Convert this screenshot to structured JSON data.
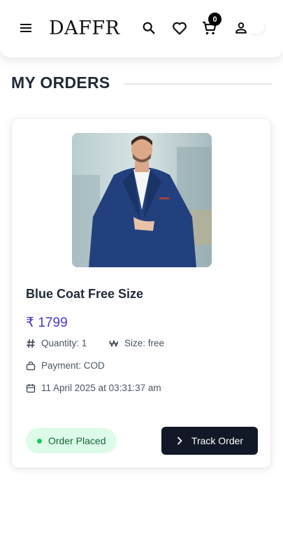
{
  "header": {
    "logo": "DAFFR",
    "cart_count": "0",
    "icons": [
      "menu-icon",
      "search-icon",
      "heart-icon",
      "cart-icon",
      "user-icon"
    ]
  },
  "page": {
    "title": "MY ORDERS"
  },
  "order": {
    "product_name": "Blue Coat Free Size",
    "price": "₹ 1799",
    "quantity": "Quantity: 1",
    "size": "Size: free",
    "payment": "Payment: COD",
    "date": "11 April 2025 at 03:31:37 am",
    "status": "Order Placed",
    "track_label": "Track Order"
  },
  "colors": {
    "price": "#4338ca",
    "status_bg": "#dcfce7",
    "status_text": "#166534",
    "status_dot": "#22c55e",
    "button_bg": "#111827"
  }
}
